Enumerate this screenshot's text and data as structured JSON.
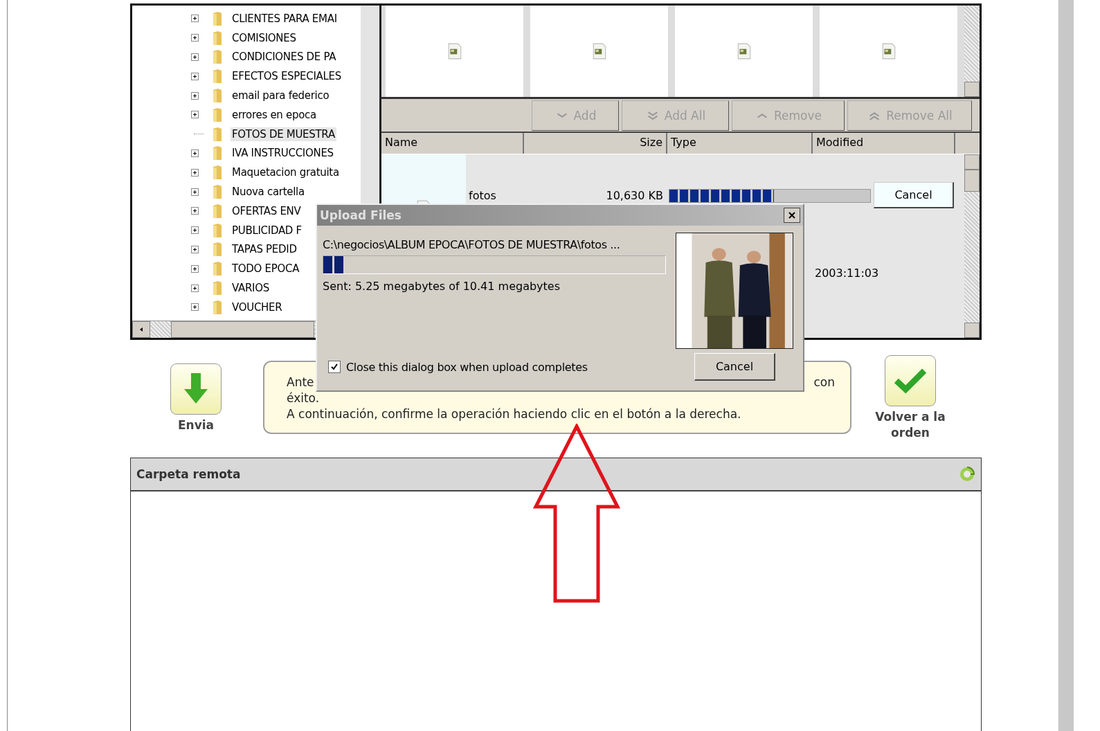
{
  "tree": {
    "items": [
      {
        "label": "CLIENTES PARA EMAI",
        "expandable": true,
        "selected": false
      },
      {
        "label": "COMISIONES",
        "expandable": true,
        "selected": false
      },
      {
        "label": "CONDICIONES DE PA",
        "expandable": true,
        "selected": false
      },
      {
        "label": "EFECTOS ESPECIALES",
        "expandable": true,
        "selected": false
      },
      {
        "label": "email para federico",
        "expandable": true,
        "selected": false
      },
      {
        "label": "errores en epoca",
        "expandable": true,
        "selected": false
      },
      {
        "label": "FOTOS DE MUESTRA",
        "expandable": false,
        "selected": true
      },
      {
        "label": "IVA INSTRUCCIONES",
        "expandable": true,
        "selected": false
      },
      {
        "label": "Maquetacion gratuita",
        "expandable": true,
        "selected": false
      },
      {
        "label": "Nuova cartella",
        "expandable": true,
        "selected": false
      },
      {
        "label": "OFERTAS ENV",
        "expandable": true,
        "selected": false
      },
      {
        "label": "PUBLICIDAD F",
        "expandable": true,
        "selected": false
      },
      {
        "label": "TAPAS PEDID",
        "expandable": true,
        "selected": false
      },
      {
        "label": "TODO EPOCA",
        "expandable": true,
        "selected": false
      },
      {
        "label": "VARIOS",
        "expandable": true,
        "selected": false
      },
      {
        "label": "VOUCHER",
        "expandable": true,
        "selected": false
      }
    ]
  },
  "queue_buttons": [
    {
      "label": "Add",
      "kind": "down",
      "disabled": true
    },
    {
      "label": "Add All",
      "kind": "down-double",
      "disabled": true
    },
    {
      "label": "Remove",
      "kind": "up",
      "disabled": true
    },
    {
      "label": "Remove All",
      "kind": "up-double",
      "disabled": true
    }
  ],
  "table": {
    "columns": [
      "Name",
      "Size",
      "Type",
      "Modified"
    ],
    "rows": [
      {
        "name": "fotos",
        "size": "10,630 KB",
        "level": 0.52,
        "action": "Cancel",
        "modified": "2003:11:03"
      }
    ]
  },
  "actions": {
    "send": {
      "label": "Envia"
    },
    "back": {
      "label": "Volver a la orden"
    },
    "info": {
      "line_start": "Ante",
      "line_end": "con",
      "line_2": "éxito.",
      "line_3": "A continuación, confirme la operación haciendo clic en el botón a la derecha."
    }
  },
  "remote_panel": {
    "title": "Carpeta remota"
  },
  "dialog": {
    "title": "Upload Files",
    "path": "C:\\negocios\\ALBUM EPOCA\\FOTOS DE MUESTRA\\fotos ...",
    "level": 0.06,
    "sent": "Sent: 5.25 megabytes of 10.41 megabytes",
    "close_when_done": {
      "label": "Close this dialog box when upload completes",
      "checked": true
    },
    "cancel": "Cancel"
  }
}
